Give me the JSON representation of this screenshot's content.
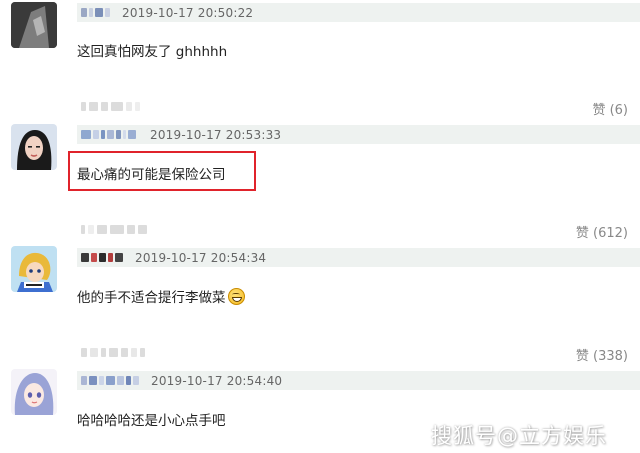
{
  "comments": [
    {
      "time": "2019-10-17 20:50:22",
      "text": "这回真怕网友了 ghhhhh"
    },
    {
      "time": "2019-10-17 20:53:33",
      "text": "最心痛的可能是保险公司",
      "likes": "赞 (6)"
    },
    {
      "time": "2019-10-17 20:54:34",
      "text": "他的手不适合提行李做菜",
      "likes": "赞 (612)",
      "emoji": "grinning-sweat-emoji"
    },
    {
      "time": "2019-10-17 20:54:40",
      "text": "哈哈哈哈还是小心点手吧",
      "likes": "赞 (338)"
    }
  ],
  "highlight_color": "#e0232b",
  "meta_bar_color": "#eef2f0",
  "watermark": "搜狐号@立方娱乐"
}
